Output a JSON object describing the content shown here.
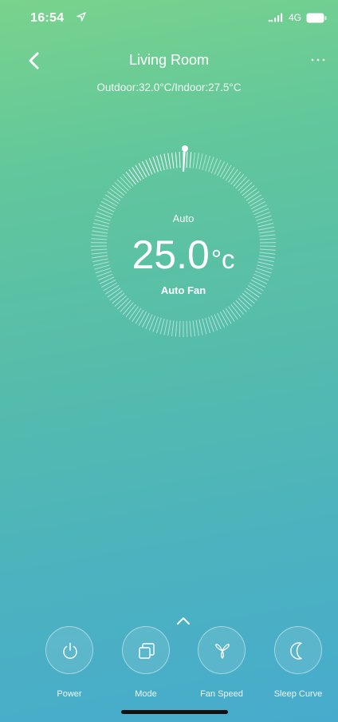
{
  "status_bar": {
    "time": "16:54",
    "network": "4G",
    "icons": [
      "location-arrow-icon",
      "signal-icon",
      "battery-icon"
    ]
  },
  "nav": {
    "title": "Living Room",
    "back_icon": "chevron-left-icon",
    "more_icon": "more-dots-icon"
  },
  "temperature_summary": "Outdoor:32.0°C/Indoor:27.5°C",
  "dial": {
    "mode": "Auto",
    "set_temperature": "25.0",
    "unit": "°c",
    "fan": "Auto Fan"
  },
  "controls": [
    {
      "label": "Power",
      "icon": "power-icon"
    },
    {
      "label": "Mode",
      "icon": "mode-icon"
    },
    {
      "label": "Fan Speed",
      "icon": "fan-icon"
    },
    {
      "label": "Sleep Curve",
      "icon": "moon-icon"
    }
  ],
  "expand_icon": "chevron-up-icon",
  "colors": {
    "gradient_top": "#79d38c",
    "gradient_bottom": "#47abcd",
    "foreground": "#ffffff"
  }
}
